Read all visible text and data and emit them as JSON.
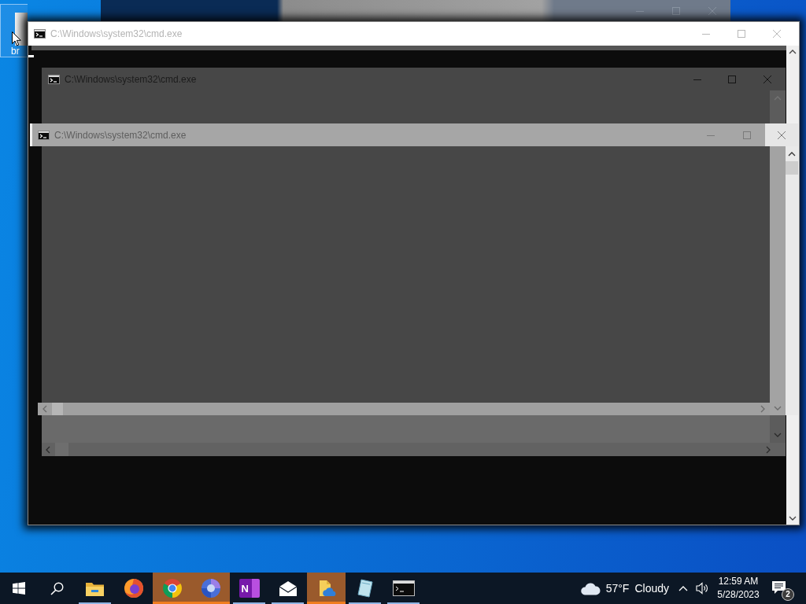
{
  "desktop": {
    "icons": [
      {
        "label": "br",
        "selected": true
      }
    ]
  },
  "windows": [
    {
      "kind": "base",
      "title": "C:\\Windows\\system32\\cmd.exe"
    },
    {
      "kind": "dark",
      "title": "C:\\Windows\\system32\\cmd.exe"
    },
    {
      "kind": "light",
      "title": "C:\\Windows\\system32\\cmd.exe"
    }
  ],
  "taskbar": {
    "apps": [
      {
        "kind": "explorer",
        "running": true,
        "flashing": false
      },
      {
        "kind": "firefox",
        "running": false,
        "flashing": false
      },
      {
        "kind": "chrome",
        "running": true,
        "flashing": true
      },
      {
        "kind": "sphere",
        "running": true,
        "flashing": true
      },
      {
        "kind": "notebook",
        "running": true,
        "flashing": false,
        "glyph": "N"
      },
      {
        "kind": "mail",
        "running": true,
        "flashing": false
      },
      {
        "kind": "cloudfolder",
        "running": true,
        "flashing": true
      },
      {
        "kind": "notepad",
        "running": true,
        "flashing": false
      },
      {
        "kind": "console",
        "running": true,
        "flashing": false
      }
    ],
    "weather": {
      "temperature": "57°F",
      "condition": "Cloudy"
    },
    "clock": {
      "time": "12:59 AM",
      "date": "5/28/2023"
    },
    "notifications": {
      "count": "2"
    }
  }
}
